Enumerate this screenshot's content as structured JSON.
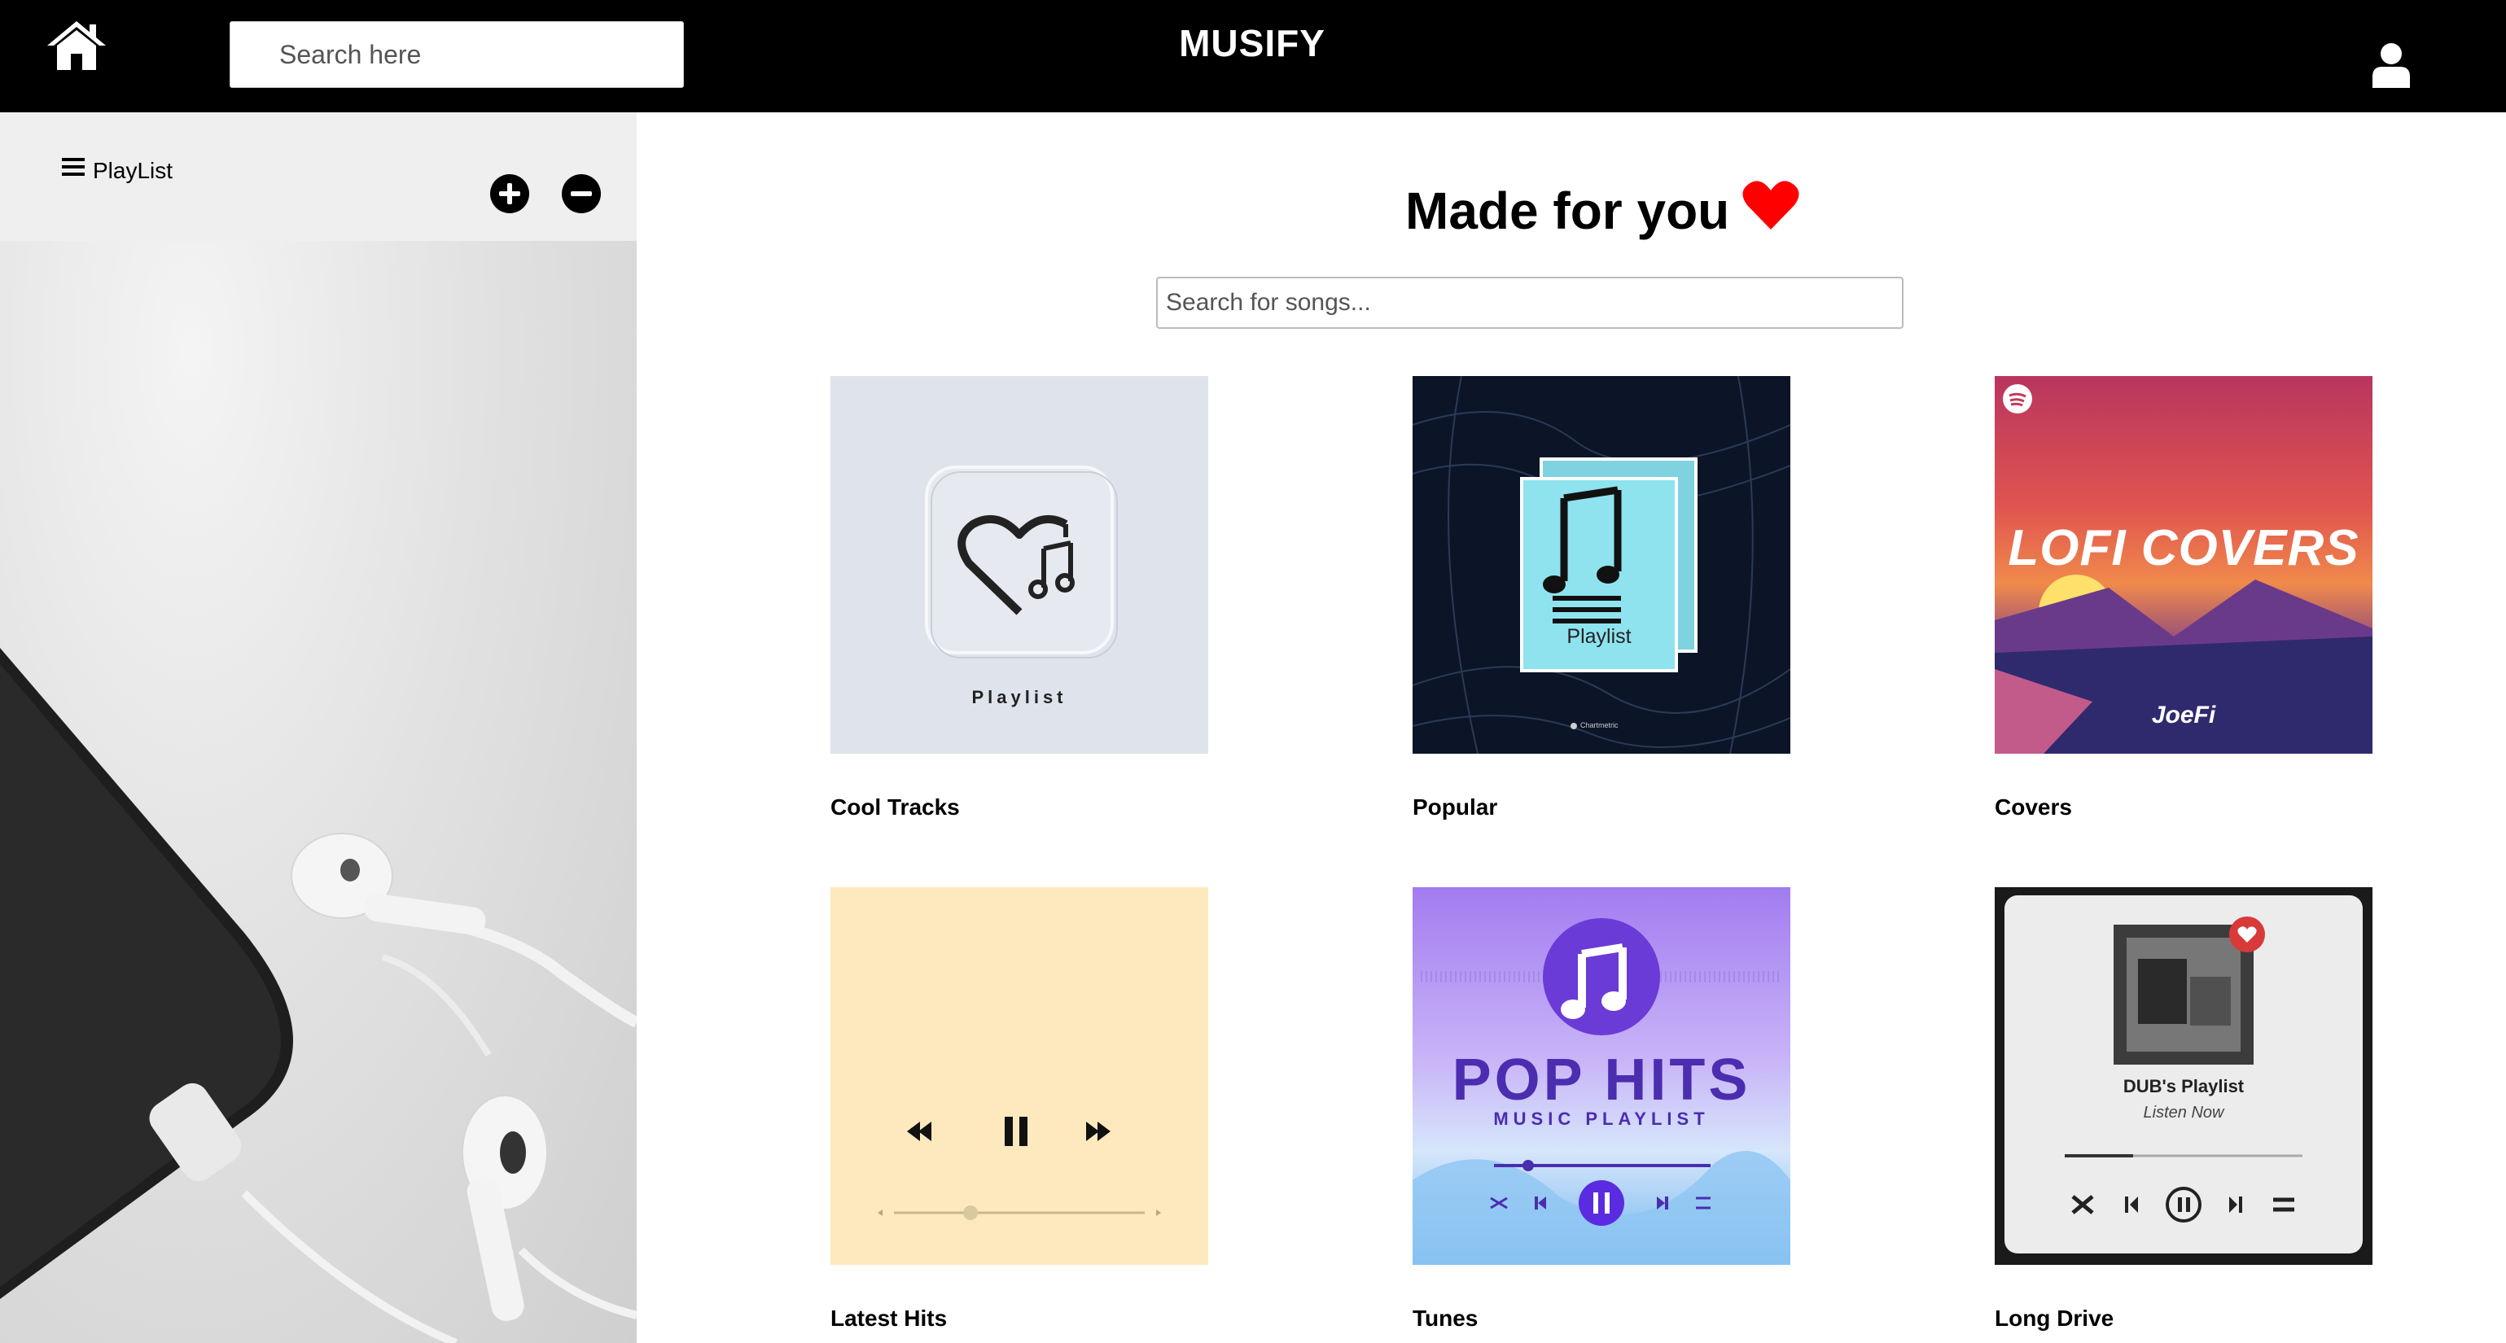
{
  "header": {
    "brand": "MUSIFY",
    "search_placeholder": "Search here"
  },
  "sidebar": {
    "playlist_label": "PlayList"
  },
  "main": {
    "title": "Made for you",
    "song_search_placeholder": "Search for songs...",
    "cards": [
      {
        "title": "Cool Tracks",
        "cover_text": "Playlist"
      },
      {
        "title": "Popular",
        "cover_text": "Playlist",
        "badge_text": "Chartmetric"
      },
      {
        "title": "Covers",
        "cover_text": "LOFI COVERS",
        "cover_subtext": "JoeFi"
      },
      {
        "title": "Latest Hits"
      },
      {
        "title": "Tunes",
        "cover_text": "POP HITS",
        "cover_subtext": "MUSIC PLAYLIST"
      },
      {
        "title": "Long Drive",
        "cover_text": "DUB's Playlist",
        "cover_subtext": "Listen Now"
      }
    ]
  },
  "colors": {
    "topbar": "#000000",
    "heart": "#ff0000",
    "sidebar_header": "#efefef"
  },
  "icons": [
    "home-icon",
    "user-icon",
    "menu-icon",
    "plus-icon",
    "minus-icon",
    "heart-icon"
  ]
}
